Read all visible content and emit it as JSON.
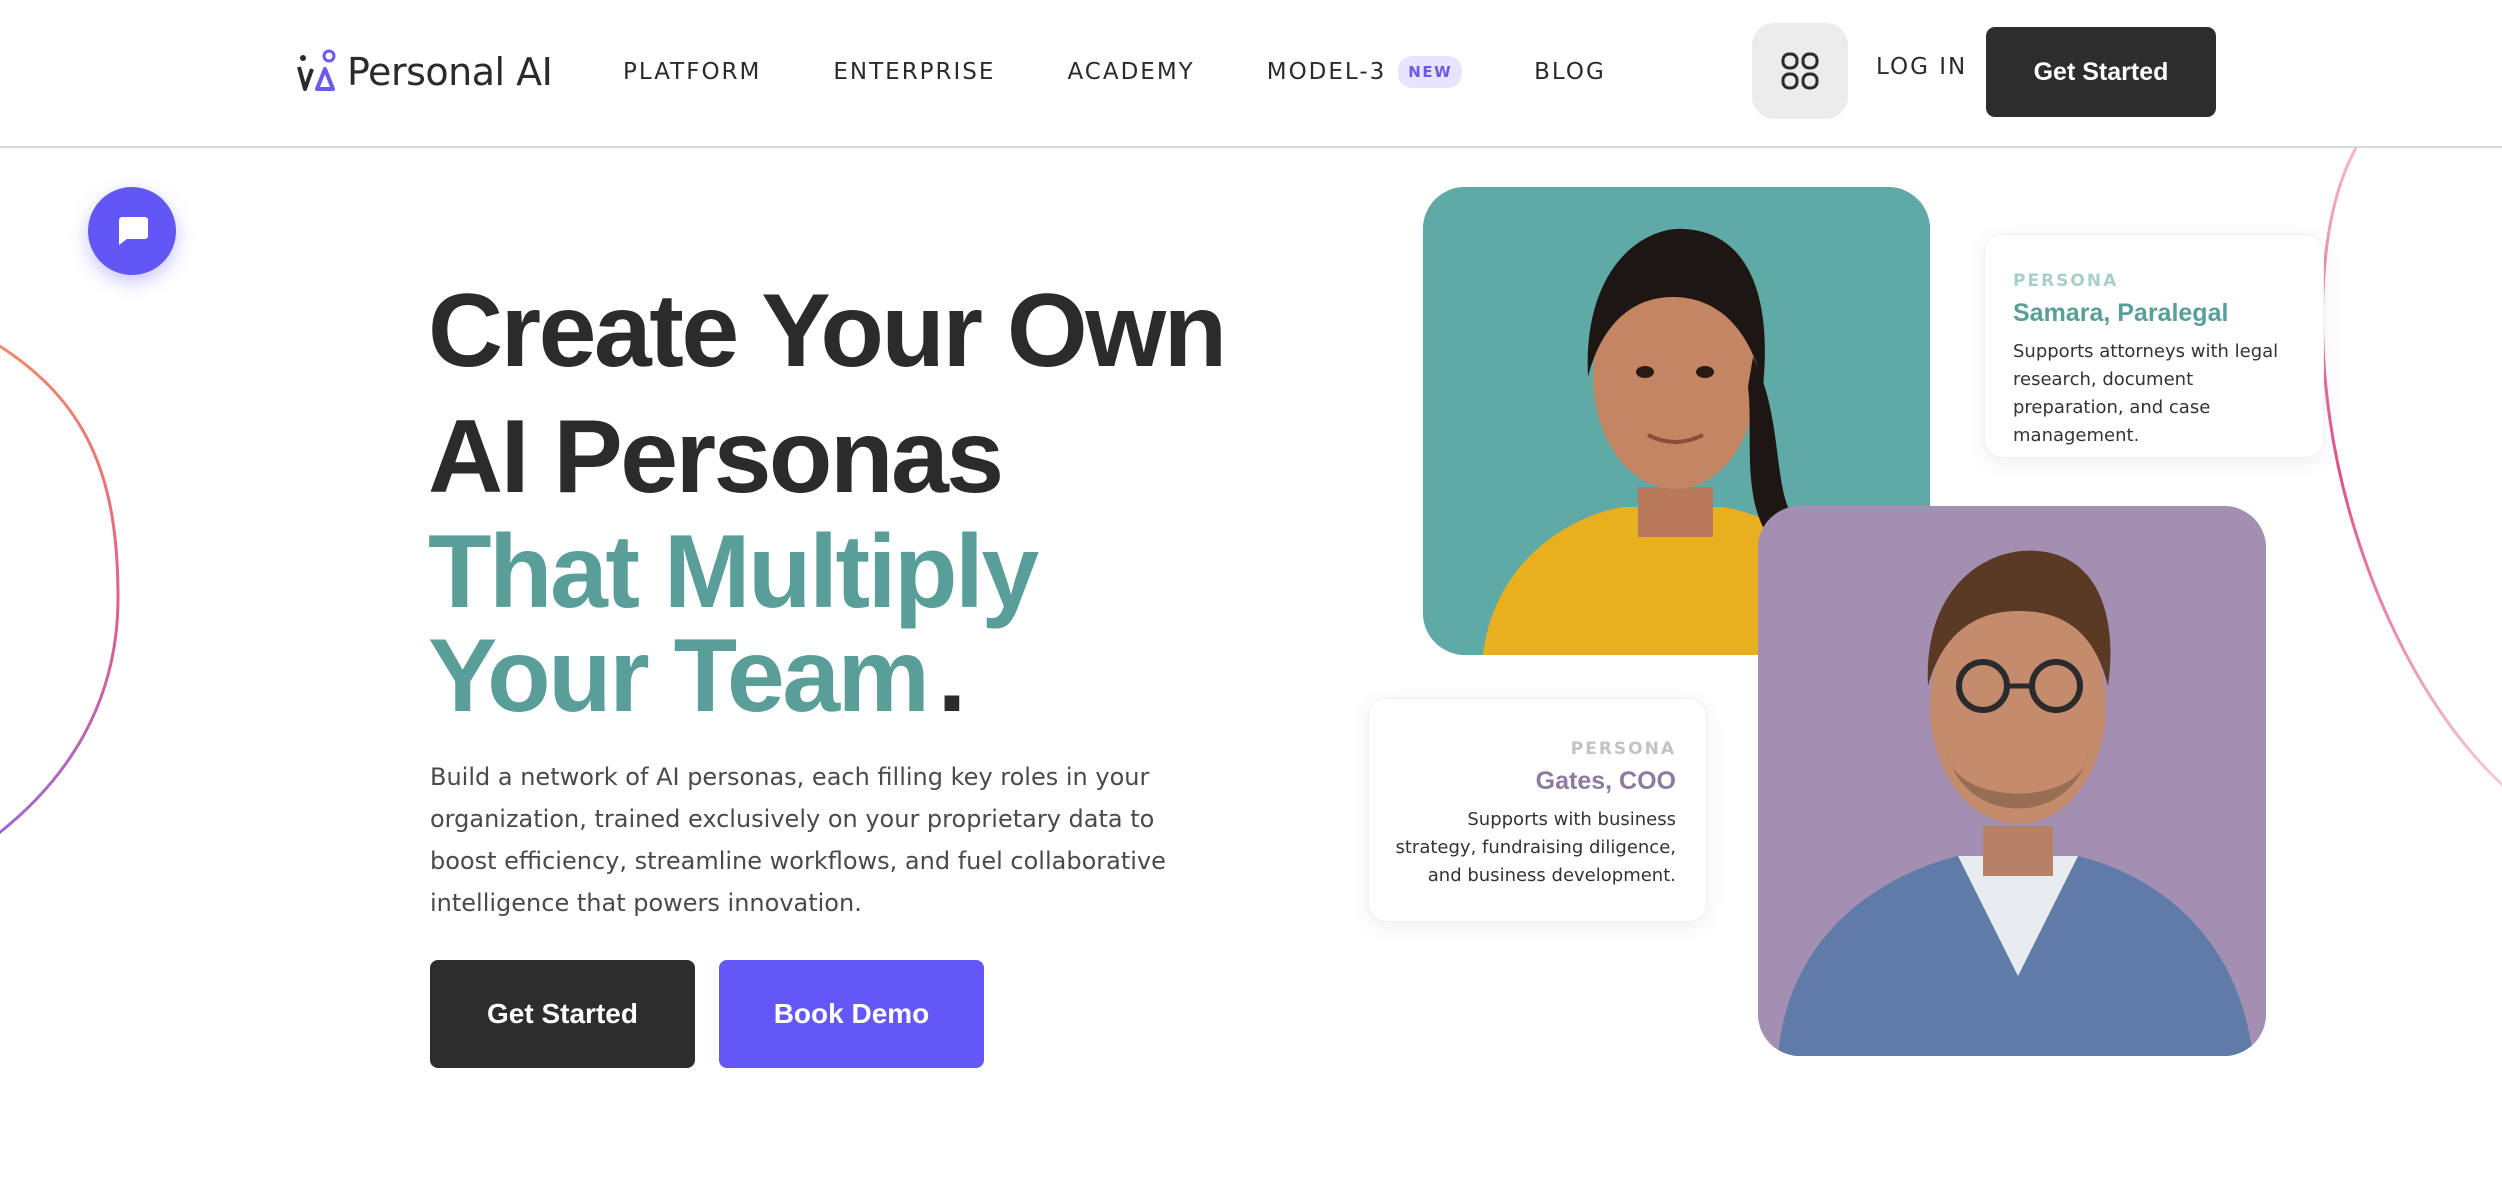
{
  "brand": {
    "name": "Personal AI",
    "accent": "#6256f5",
    "teal": "#5a9e99"
  },
  "nav": {
    "items": [
      {
        "label": "PLATFORM"
      },
      {
        "label": "ENTERPRISE"
      },
      {
        "label": "ACADEMY"
      },
      {
        "label": "MODEL-3",
        "badge": "NEW"
      },
      {
        "label": "BLOG"
      }
    ],
    "apps_icon": "grid-icon",
    "login_label": "LOG IN",
    "cta_label": "Get Started"
  },
  "chat": {
    "icon": "chat-icon"
  },
  "hero": {
    "title_line1": "Create Your Own",
    "title_line2": "AI Personas",
    "accent_line1": "That Multiply",
    "accent_line2": "Your Team",
    "dot": ".",
    "description": "Build a network of AI personas, each filling key roles in your organization, trained exclusively on your proprietary data to boost efficiency, streamline workflows, and fuel collaborative intelligence that powers innovation.",
    "primary_button": "Get Started",
    "secondary_button": "Book Demo"
  },
  "personas": [
    {
      "label": "PERSONA",
      "name": "Samara, Paralegal",
      "description": "Supports attorneys with legal research, document preparation, and case management.",
      "photo_bg": "#5fa9a6"
    },
    {
      "label": "PERSONA",
      "name": "Gates, COO",
      "description": "Supports with business strategy, fundraising diligence, and business development.",
      "photo_bg": "#a38fb1"
    }
  ]
}
